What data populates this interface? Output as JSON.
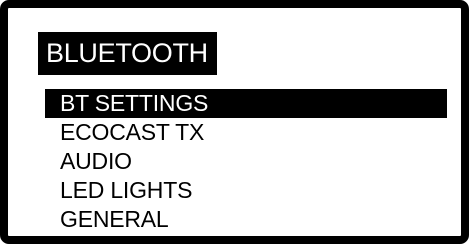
{
  "screen": {
    "title": "BLUETOOTH"
  },
  "menu": {
    "selected_index": 0,
    "items": [
      {
        "label": "BT SETTINGS"
      },
      {
        "label": "ECOCAST TX"
      },
      {
        "label": "AUDIO"
      },
      {
        "label": "LED LIGHTS"
      },
      {
        "label": "GENERAL"
      }
    ]
  }
}
